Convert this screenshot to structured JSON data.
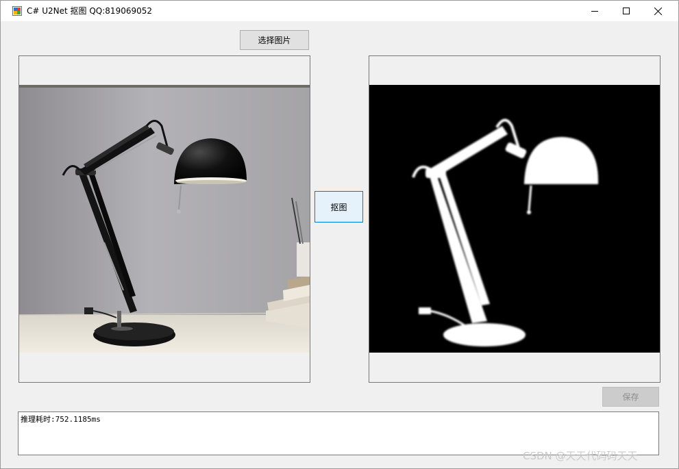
{
  "window": {
    "title": "C# U2Net 抠图 QQ:819069052",
    "icon": "app-icon"
  },
  "buttons": {
    "select_image": "选择图片",
    "cutout": "抠图",
    "save": "保存"
  },
  "images": {
    "source": "desk-lamp-photo",
    "result": "desk-lamp-mask"
  },
  "log": {
    "text": "推理耗时:752.1185ms"
  },
  "watermark": "CSDN @天天代码码天天",
  "colors": {
    "window_bg": "#f0f0f0",
    "titlebar_bg": "#ffffff",
    "active_button_border": "#0078d7",
    "active_button_bg": "#e5f1fb"
  }
}
